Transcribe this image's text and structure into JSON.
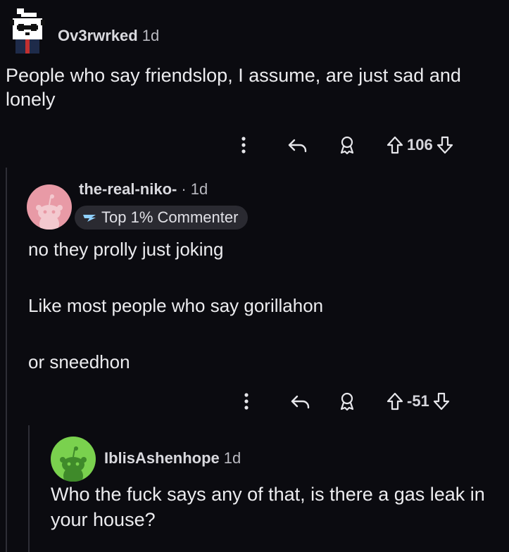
{
  "comments": [
    {
      "username": "Ov3rwrked",
      "time": "1d",
      "body": "People who say friendslop, I assume, are just sad and lonely",
      "score": "106",
      "icons": [
        "avatar-panda-icon",
        "more-vertical-icon",
        "reply-icon",
        "award-icon",
        "upvote-icon",
        "downvote-icon"
      ]
    },
    {
      "username": "the-real-niko-",
      "time": "· 1d",
      "badge": "Top 1% Commenter",
      "body": [
        "no they prolly just joking",
        "Like most people who say gorillahon",
        "or sneedhon"
      ],
      "score": "-51",
      "avatar_color": "#e89aa6"
    },
    {
      "username": "IblisAshenhope",
      "time": "1d",
      "body": "Who the fuck says any of that, is there a gas leak in your house?",
      "avatar_color": "#7ad14e"
    }
  ],
  "colors": {
    "background": "#0b0b10",
    "text": "#ececef",
    "badge_bg": "#2a2a31"
  }
}
